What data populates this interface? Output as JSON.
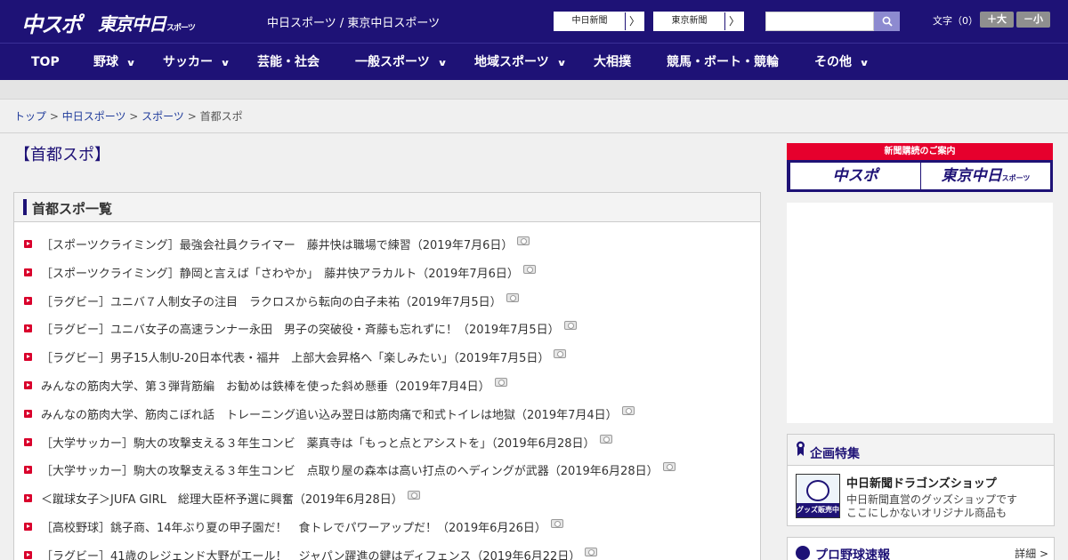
{
  "header": {
    "logo_chuspo": "中スポ",
    "logo_tokyo": "東京中日",
    "logo_tokyo_small": "スポーツ",
    "site_title": "中日スポーツ / 東京中日スポーツ",
    "btn_chunichi": "中日新聞",
    "btn_tokyo": "東京新聞",
    "arrow": "〉",
    "search_placeholder": "",
    "fontsize_label": "文字（0）",
    "fs_big": "＋大",
    "fs_small": "－小"
  },
  "nav": {
    "items": [
      {
        "label": "TOP",
        "chevron": ""
      },
      {
        "label": "野球",
        "chevron": "∨"
      },
      {
        "label": "サッカー",
        "chevron": "∨"
      },
      {
        "label": "芸能・社会",
        "chevron": ""
      },
      {
        "label": "一般スポーツ",
        "chevron": "∨"
      },
      {
        "label": "地域スポーツ",
        "chevron": "∨"
      },
      {
        "label": "大相撲",
        "chevron": ""
      },
      {
        "label": "競馬・ボート・競輪",
        "chevron": ""
      },
      {
        "label": "その他",
        "chevron": "∨"
      }
    ]
  },
  "breadcrumb": {
    "top": "トップ",
    "chunichi": "中日スポーツ",
    "sports": "スポーツ",
    "sep": " > ",
    "current": "首都スポ"
  },
  "main": {
    "heading": "【首都スポ】",
    "list_title": "首都スポ一覧",
    "articles": [
      "［スポーツクライミング］最強会社員クライマー　藤井快は職場で練習（2019年7月6日）",
      "［スポーツクライミング］静岡と言えば「さわやか」　藤井快アラカルト（2019年7月6日）",
      "［ラグビー］ユニバ７人制女子の注目　ラクロスから転向の白子未祐（2019年7月5日）",
      "［ラグビー］ユニバ女子の高速ランナー永田　男子の突破役・斉藤も忘れずに！（2019年7月5日）",
      "［ラグビー］男子15人制U-20日本代表・福井　上部大会昇格へ「楽しみたい」（2019年7月5日）",
      "みんなの筋肉大学、第３弾背筋編　お勧めは鉄棒を使った斜め懸垂（2019年7月4日）",
      "みんなの筋肉大学、筋肉こぼれ話　トレーニング追い込み翌日は筋肉痛で和式トイレは地獄（2019年7月4日）",
      "［大学サッカー］駒大の攻撃支える３年生コンビ　薬真寺は「もっと点とアシストを」（2019年6月28日）",
      "［大学サッカー］駒大の攻撃支える３年生コンビ　点取り屋の森本は高い打点のヘディングが武器（2019年6月28日）",
      "＜蹴球女子＞JUFA GIRL　総理大臣杯予選に興奮（2019年6月28日）",
      "［高校野球］銚子商、14年ぶり夏の甲子園だ！　食トレでパワーアップだ！（2019年6月26日）",
      "［ラグビー］41歳のレジェンド大野がエール！　ジャパン躍進の鍵はディフェンス（2019年6月22日）"
    ]
  },
  "sidebar": {
    "subscribe_head": "新聞購読のご案内",
    "sub_chuspo": "中スポ",
    "sub_tokyo": "東京中日",
    "sub_tokyo_small": "スポーツ",
    "feature_title": "企画特集",
    "shop_badge": "グッズ販売中",
    "shop_title": "中日新聞ドラゴンズショップ",
    "shop_desc1": "中日新聞直営のグッズショップです",
    "shop_desc2": "ここにしかないオリジナル商品も",
    "baseball_title": "プロ野球速報",
    "baseball_more": "詳細 >"
  },
  "colors": {
    "brand_navy": "#1e1276",
    "accent_red": "#e6002d",
    "link_blue": "#1e3a9a"
  }
}
